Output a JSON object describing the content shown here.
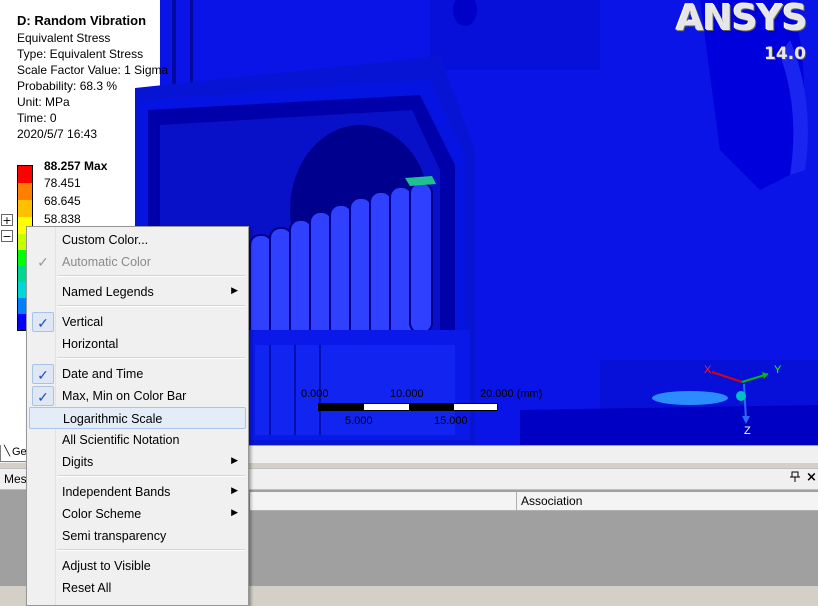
{
  "overlay": {
    "title": "D: Random Vibration",
    "lines": [
      "Equivalent Stress",
      "Type: Equivalent Stress",
      "Scale Factor Value: 1 Sigma",
      "Probability: 68.3 %",
      "Unit: MPa",
      "Time: 0",
      "2020/5/7 16:43"
    ]
  },
  "logo": {
    "brand": "ANSYS",
    "version": "14.0"
  },
  "legend": {
    "max_label": "88.257 Max",
    "values": [
      "78.451",
      "68.645",
      "58.838"
    ],
    "plus": "+",
    "minus": "−",
    "colors": [
      "#ff0000",
      "#ff8000",
      "#ffc000",
      "#ffff00",
      "#c8ff00",
      "#00ff00",
      "#00d890",
      "#00d8d8",
      "#0080ff",
      "#0000ff"
    ]
  },
  "scale_ruler": {
    "top_labels": [
      "0.000",
      "10.000",
      "20.000 (mm)"
    ],
    "bottom_labels": [
      "5.000",
      "15.000"
    ]
  },
  "triad": {
    "x": "X",
    "y": "Y",
    "z": "Z"
  },
  "tabs": {
    "geometry_abbrev": "Ge"
  },
  "panel": {
    "title_abbrev": "Mes",
    "pin": "📌",
    "close": "×",
    "column_association": "Association"
  },
  "context_menu": {
    "items": [
      {
        "label": "Custom Color...",
        "checked": false,
        "disabled": false,
        "submenu": false
      },
      {
        "label": "Automatic Color",
        "checked": true,
        "disabled": true,
        "submenu": false
      },
      {
        "label": "Named Legends",
        "checked": false,
        "disabled": false,
        "submenu": true
      },
      {
        "label": "Vertical",
        "checked": true,
        "disabled": false,
        "submenu": false
      },
      {
        "label": "Horizontal",
        "checked": false,
        "disabled": false,
        "submenu": false
      },
      {
        "label": "Date and Time",
        "checked": true,
        "disabled": false,
        "submenu": false
      },
      {
        "label": "Max, Min on Color Bar",
        "checked": true,
        "disabled": false,
        "submenu": false
      },
      {
        "label": "Logarithmic Scale",
        "checked": false,
        "disabled": false,
        "submenu": false,
        "highlighted": true
      },
      {
        "label": "All Scientific Notation",
        "checked": false,
        "disabled": false,
        "submenu": false
      },
      {
        "label": "Digits",
        "checked": false,
        "disabled": false,
        "submenu": true
      },
      {
        "label": "Independent Bands",
        "checked": false,
        "disabled": false,
        "submenu": true
      },
      {
        "label": "Color Scheme",
        "checked": false,
        "disabled": false,
        "submenu": true
      },
      {
        "label": "Semi transparency",
        "checked": false,
        "disabled": false,
        "submenu": false
      },
      {
        "label": "Adjust to Visible",
        "checked": false,
        "disabled": false,
        "submenu": false
      },
      {
        "label": "Reset All",
        "checked": false,
        "disabled": false,
        "submenu": false
      }
    ],
    "check_glyph": "✓",
    "arrow_glyph": "▶"
  }
}
